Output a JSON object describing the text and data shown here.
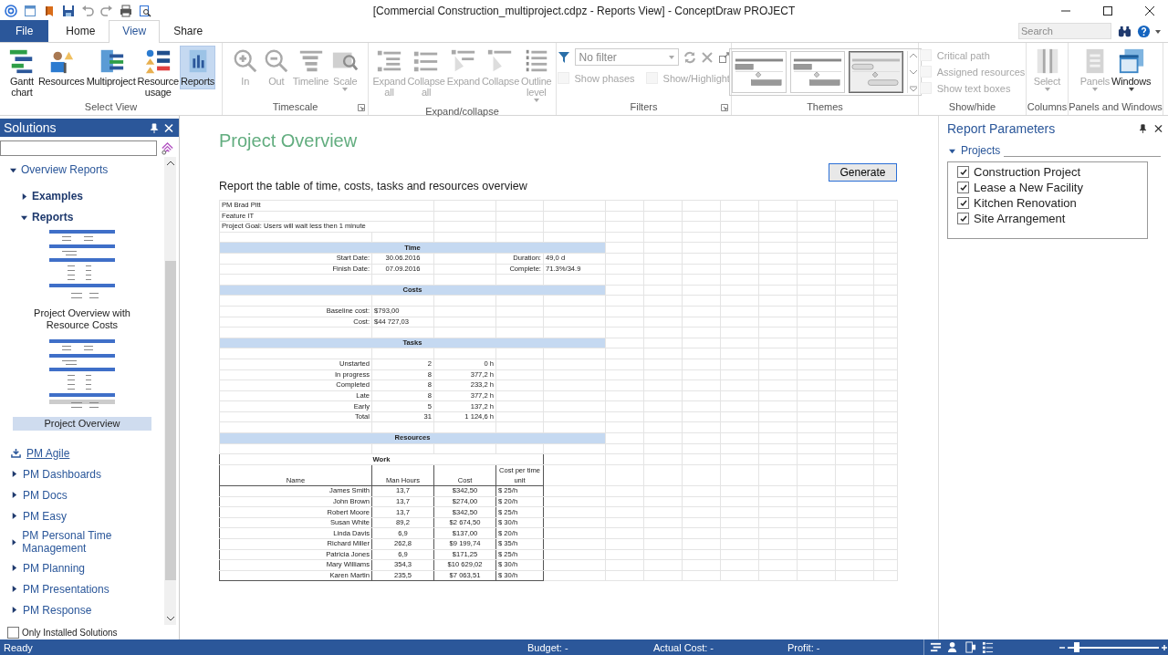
{
  "window": {
    "title": "[Commercial Construction_multiproject.cdpz - Reports View] - ConceptDraw PROJECT"
  },
  "tabs": [
    {
      "label": "File",
      "kind": "file",
      "selected": false
    },
    {
      "label": "Home",
      "kind": "tab",
      "selected": false
    },
    {
      "label": "View",
      "kind": "tab",
      "selected": true
    },
    {
      "label": "Share",
      "kind": "tab",
      "selected": false
    }
  ],
  "search": {
    "placeholder": "Search"
  },
  "ribbon": {
    "groups": [
      {
        "name": "Select View",
        "kind": "buttons",
        "buttons": [
          {
            "label": "Gantt chart",
            "disabled": false,
            "selected": false
          },
          {
            "label": "Resources",
            "disabled": false,
            "selected": false
          },
          {
            "label": "Multiproject",
            "disabled": false,
            "selected": false
          },
          {
            "label": "Resource usage",
            "disabled": false,
            "selected": false
          },
          {
            "label": "Reports",
            "disabled": false,
            "selected": true
          }
        ]
      },
      {
        "name": "Timescale",
        "kind": "buttons",
        "launcher": true,
        "buttons": [
          {
            "label": "In",
            "disabled": true
          },
          {
            "label": "Out",
            "disabled": true
          },
          {
            "label": "Timeline",
            "disabled": true
          },
          {
            "label": "Scale",
            "disabled": true,
            "dropdown": true
          }
        ]
      },
      {
        "name": "Expand/collapse",
        "kind": "buttons",
        "buttons": [
          {
            "label": "Expand all",
            "disabled": true
          },
          {
            "label": "Collapse all",
            "disabled": true
          },
          {
            "label": "Expand",
            "disabled": true
          },
          {
            "label": "Collapse",
            "disabled": true
          },
          {
            "label": "Outline level",
            "disabled": true,
            "dropdown": true
          }
        ]
      },
      {
        "name": "Filters",
        "kind": "filters",
        "launcher": true,
        "filter": {
          "value": "No filter"
        },
        "checks": [
          {
            "label": "Show phases",
            "checked": false,
            "disabled": true
          },
          {
            "label": "Show/Highlight",
            "checked": false,
            "disabled": true
          }
        ]
      },
      {
        "name": "Themes",
        "kind": "themes",
        "themes": [
          {
            "selected": false
          },
          {
            "selected": false
          },
          {
            "selected": true
          }
        ]
      },
      {
        "name": "Show/hide",
        "kind": "checks",
        "checks": [
          {
            "label": "Critical path",
            "checked": false,
            "disabled": true
          },
          {
            "label": "Assigned resources",
            "checked": false,
            "disabled": true
          },
          {
            "label": "Show text boxes",
            "checked": false,
            "disabled": true
          }
        ]
      },
      {
        "name": "Columns",
        "kind": "buttons",
        "buttons": [
          {
            "label": "Select",
            "disabled": true,
            "dropdown": true
          }
        ]
      },
      {
        "name": "Panels and Windows",
        "kind": "buttons",
        "buttons": [
          {
            "label": "Panels",
            "disabled": true,
            "dropdown": true
          },
          {
            "label": "Windows",
            "disabled": false,
            "dropdown": true
          }
        ]
      }
    ]
  },
  "solutions_panel": {
    "title": "Solutions",
    "tree": [
      {
        "label": "Overview Reports",
        "expanded": true,
        "children": [
          {
            "label": "Examples",
            "expanded": false
          },
          {
            "label": "Reports",
            "expanded": true,
            "templates": [
              {
                "label": "Project Overview with Resource Costs",
                "selected": false
              },
              {
                "label": "Project Overview",
                "selected": true
              }
            ]
          }
        ]
      }
    ],
    "solutions": [
      {
        "label": "PM Agile",
        "kind": "download"
      },
      {
        "label": "PM Dashboards",
        "kind": "folder"
      },
      {
        "label": "PM Docs",
        "kind": "folder"
      },
      {
        "label": "PM Easy",
        "kind": "folder"
      },
      {
        "label": "PM Personal Time Management",
        "kind": "folder"
      },
      {
        "label": "PM Planning",
        "kind": "folder"
      },
      {
        "label": "PM Presentations",
        "kind": "folder"
      },
      {
        "label": "PM Response",
        "kind": "folder"
      }
    ],
    "only_installed": {
      "label": "Only Installed Solutions",
      "checked": false
    }
  },
  "report": {
    "title": "Project Overview",
    "description": "Report the table of time, costs, tasks and resources overview",
    "generate_button": "Generate",
    "header_lines": [
      "PM Brad Pitt",
      "Feature IT",
      "Project Goal: Users will wait less then 1 minute"
    ],
    "time": {
      "heading": "Time",
      "rows": [
        {
          "label": "Start Date:",
          "value": "30.06.2016",
          "label_2": "Duration:",
          "value_2": "49,0 d"
        },
        {
          "label": "Finish Date:",
          "value": "07.09.2016",
          "label_2": "Complete:",
          "value_2": "71.3%/34.9"
        }
      ]
    },
    "costs": {
      "heading": "Costs",
      "rows": [
        {
          "label": "Baseline cost:",
          "value": "$793,00"
        },
        {
          "label": "Cost:",
          "value": "$44 727,03"
        }
      ]
    },
    "tasks": {
      "heading": "Tasks",
      "rows": [
        {
          "label": "Unstarted",
          "count": "2",
          "hours": "0 h"
        },
        {
          "label": "In progress",
          "count": "8",
          "hours": "377,2 h"
        },
        {
          "label": "Completed",
          "count": "8",
          "hours": "233,2 h"
        },
        {
          "label": "Late",
          "count": "8",
          "hours": "377,2 h"
        },
        {
          "label": "Early",
          "count": "5",
          "hours": "137,2 h"
        }
      ],
      "total": {
        "label": "Total",
        "count": "31",
        "hours": "1 124,6 h"
      }
    },
    "resources": {
      "heading": "Resources",
      "group_heading": "Work",
      "columns": [
        "Name",
        "Man Hours",
        "Cost",
        "Cost per time unit"
      ],
      "rows": [
        {
          "name": "James Smith",
          "man_hours": "13,7",
          "cost": "$342,50",
          "rate": "$ 25/h"
        },
        {
          "name": "John Brown",
          "man_hours": "13,7",
          "cost": "$274,00",
          "rate": "$ 20/h"
        },
        {
          "name": "Robert Moore",
          "man_hours": "13,7",
          "cost": "$342,50",
          "rate": "$ 25/h"
        },
        {
          "name": "Susan White",
          "man_hours": "89,2",
          "cost": "$2 674,50",
          "rate": "$ 30/h"
        },
        {
          "name": "Linda Davis",
          "man_hours": "6,9",
          "cost": "$137,00",
          "rate": "$ 20/h"
        },
        {
          "name": "Richard Miller",
          "man_hours": "262,8",
          "cost": "$9 199,74",
          "rate": "$ 35/h"
        },
        {
          "name": "Patricia Jones",
          "man_hours": "6,9",
          "cost": "$171,25",
          "rate": "$ 25/h"
        },
        {
          "name": "Mary Williams",
          "man_hours": "354,3",
          "cost": "$10 629,02",
          "rate": "$ 30/h"
        },
        {
          "name": "Karen Martin",
          "man_hours": "235,5",
          "cost": "$7 063,51",
          "rate": "$ 30/h"
        }
      ]
    }
  },
  "parameters_panel": {
    "title": "Report Parameters",
    "section": {
      "label": "Projects",
      "expanded": true
    },
    "projects": [
      {
        "label": "Construction Project",
        "checked": true
      },
      {
        "label": "Lease a New Facility",
        "checked": true
      },
      {
        "label": "Kitchen Renovation",
        "checked": true
      },
      {
        "label": "Site Arrangement",
        "checked": true
      }
    ]
  },
  "status_bar": {
    "status": "Ready",
    "budget": "Budget: -",
    "actual_cost": "Actual Cost: -",
    "profit": "Profit: -",
    "zoom": {
      "level": 0.1
    }
  }
}
